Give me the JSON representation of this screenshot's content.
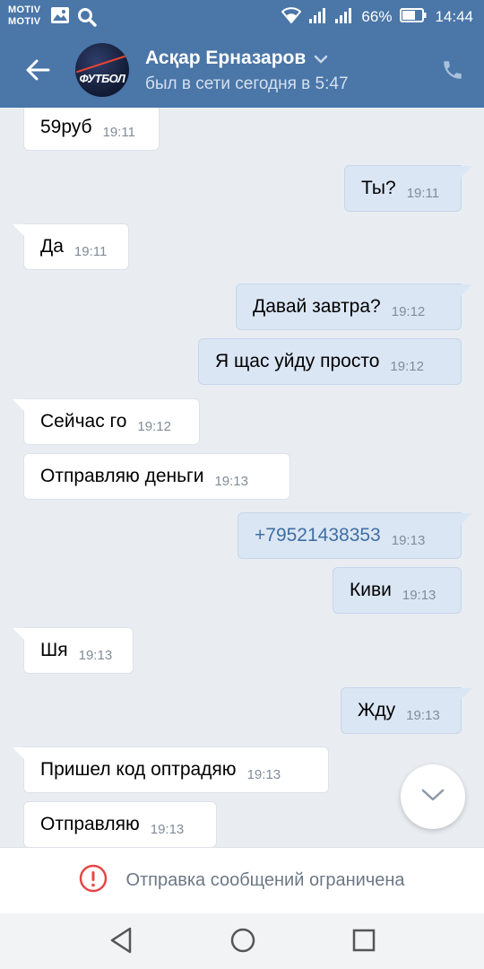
{
  "status_bar": {
    "carrier_line1": "MOTIV",
    "carrier_line2": "MOTIV",
    "battery": "66%",
    "time": "14:44"
  },
  "header": {
    "contact_name": "Асқар Ерназаров",
    "last_seen": "был в сети сегодня в 5:47",
    "avatar_text": "ФУТБОЛ"
  },
  "messages": [
    {
      "dir": "in",
      "text": "59руб",
      "time": "19:11"
    },
    {
      "dir": "out",
      "text": "Ты?",
      "time": "19:11"
    },
    {
      "dir": "in",
      "text": "Да",
      "time": "19:11"
    },
    {
      "dir": "out",
      "text": "Давай завтра?",
      "time": "19:12"
    },
    {
      "dir": "out",
      "text": "Я щас уйду просто",
      "time": "19:12"
    },
    {
      "dir": "in",
      "text": "Сейчас го",
      "time": "19:12"
    },
    {
      "dir": "in",
      "text": "Отправляю деньги",
      "time": "19:13"
    },
    {
      "dir": "out",
      "text": "+79521438353",
      "time": "19:13"
    },
    {
      "dir": "out",
      "text": "Киви",
      "time": "19:13"
    },
    {
      "dir": "in",
      "text": "Шя",
      "time": "19:13"
    },
    {
      "dir": "out",
      "text": "Жду",
      "time": "19:13"
    },
    {
      "dir": "in",
      "text": "Пришел код оптрадяю",
      "time": "19:13"
    },
    {
      "dir": "in",
      "text": "Отправляю",
      "time": "19:13"
    }
  ],
  "footer": {
    "restricted_text": "Отправка сообщений ограничена"
  },
  "colors": {
    "header_bg": "#4a76a8",
    "chat_bg": "#e9edf2",
    "outgoing_bubble": "#dbe6f4",
    "incoming_bubble": "#ffffff",
    "alert_red": "#e64646"
  }
}
